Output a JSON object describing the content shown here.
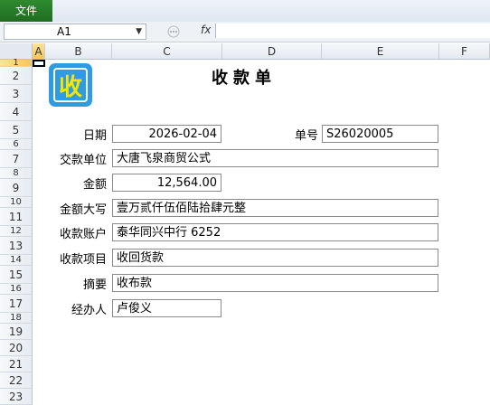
{
  "ribbon": {
    "file_tab": "文件"
  },
  "formula_bar": {
    "name_box": "A1",
    "fx": "fx",
    "value": ""
  },
  "columns": [
    "A",
    "B",
    "C",
    "D",
    "E",
    "F"
  ],
  "rows": [
    "1",
    "2",
    "3",
    "4",
    "5",
    "6",
    "7",
    "8",
    "9",
    "10",
    "11",
    "12",
    "13",
    "14",
    "15",
    "16",
    "17",
    "18",
    "19",
    "20",
    "21",
    "22",
    "23"
  ],
  "logo": {
    "char": "收"
  },
  "form": {
    "title": "收款单",
    "date_label": "日期",
    "date_value": "2026-02-04",
    "number_label": "单号",
    "number_value": "S26020005",
    "payer_label": "交款单位",
    "payer_value": "大唐飞泉商贸公式",
    "amount_label": "金额",
    "amount_value": "12,564.00",
    "amount_upper_label": "金额大写",
    "amount_upper_value": "壹万贰仟伍佰陆拾肆元整",
    "account_label": "收款账户",
    "account_value": "泰华同兴中行 6252",
    "item_label": "收款项目",
    "item_value": "收回货款",
    "summary_label": "摘要",
    "summary_value": "收布款",
    "handler_label": "经办人",
    "handler_value": "卢俊义"
  }
}
